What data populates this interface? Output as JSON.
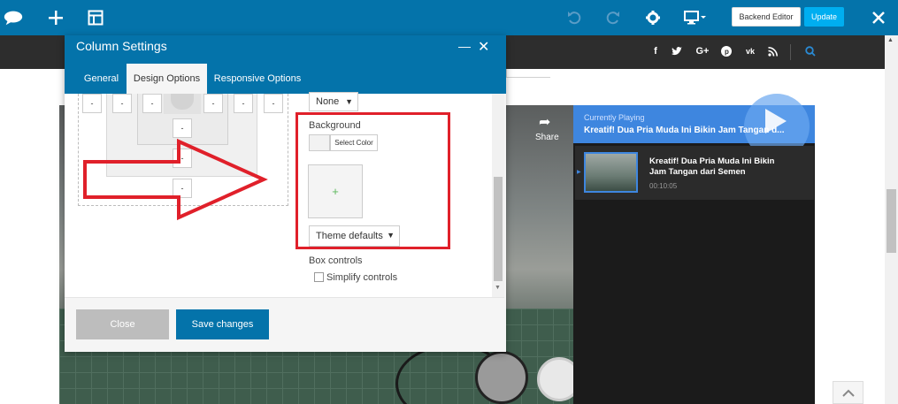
{
  "topbar": {
    "icons": [
      "logo-cloud-icon",
      "add-icon",
      "layout-icon",
      "undo-icon",
      "redo-icon",
      "settings-gear-icon",
      "responsive-monitor-icon",
      "close-icon"
    ],
    "backend_editor_label": "Backend Editor",
    "update_label": "Update",
    "color": "#0473aa"
  },
  "site_header": {
    "social_icons": [
      "facebook-icon",
      "twitter-icon",
      "google-plus-icon",
      "pinterest-icon",
      "vk-icon",
      "rss-icon",
      "search-icon"
    ]
  },
  "modal": {
    "title": "Column Settings",
    "tabs": [
      {
        "label": "General",
        "active": false
      },
      {
        "label": "Design Options",
        "active": true
      },
      {
        "label": "Responsive Options",
        "active": false
      }
    ],
    "box_model_placeholder": "-",
    "border_style_value": "None",
    "background_label": "Background",
    "select_color_label": "Select Color",
    "add_image_symbol": "+",
    "background_style_value": "Theme defaults",
    "box_controls_label": "Box controls",
    "simplify_controls_label": "Simplify controls",
    "simplify_controls_checked": false,
    "close_label": "Close",
    "save_label": "Save changes"
  },
  "video": {
    "share_label": "Share",
    "currently_playing_label": "Currently Playing",
    "current_title": "Kreatif! Dua Pria Muda Ini Bikin Jam Tangan d...",
    "playlist": [
      {
        "title": "Kreatif! Dua Pria Muda Ini Bikin Jam Tangan dari Semen",
        "duration": "00:10:05"
      }
    ]
  },
  "annotation": {
    "highlight_color": "#e0202a"
  }
}
